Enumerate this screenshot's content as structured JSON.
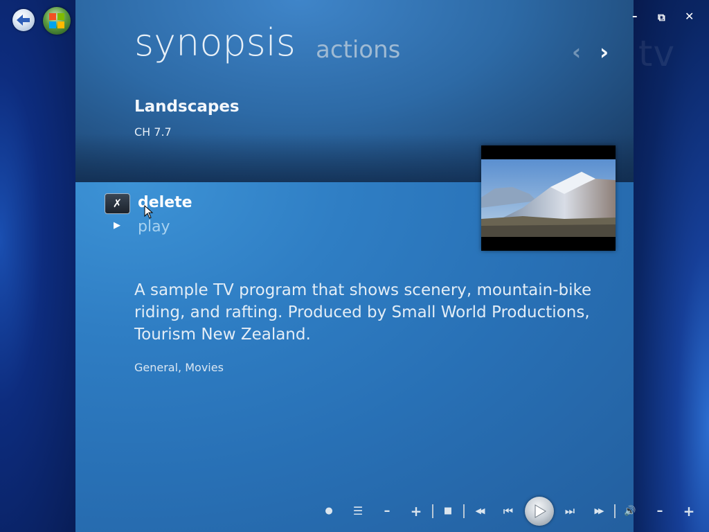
{
  "header": {
    "title": "synopsis",
    "secondary": "actions",
    "ghost_label": "tv"
  },
  "program": {
    "title": "Landscapes",
    "channel": "CH 7.7",
    "description": "A sample TV program that shows scenery, mountain-bike riding, and rafting. Produced by Small World Productions, Tourism New Zealand.",
    "genres": "General, Movies"
  },
  "actions": [
    {
      "label": "delete",
      "icon": "delete-icon",
      "selected": true
    },
    {
      "label": "play",
      "icon": "play-icon",
      "selected": false
    }
  ],
  "nav": {
    "prev_glyph": "‹",
    "next_glyph": "›"
  },
  "window_controls": {
    "minimize": "–",
    "restore": "⧉",
    "close": "✕"
  },
  "transport": {
    "record": "●",
    "guide": "☰",
    "channel_down": "–",
    "channel_up": "+",
    "stop": "■",
    "rewind": "◀◀",
    "skip_back": "⏮",
    "skip_forward": "⏭",
    "fast_forward": "▶▶",
    "mute": "🔊",
    "volume_down": "–",
    "volume_up": "+"
  },
  "colors": {
    "panel_blue": "#2870b5",
    "text_light": "#e3edf6",
    "play_label": "#a8d2f0"
  }
}
